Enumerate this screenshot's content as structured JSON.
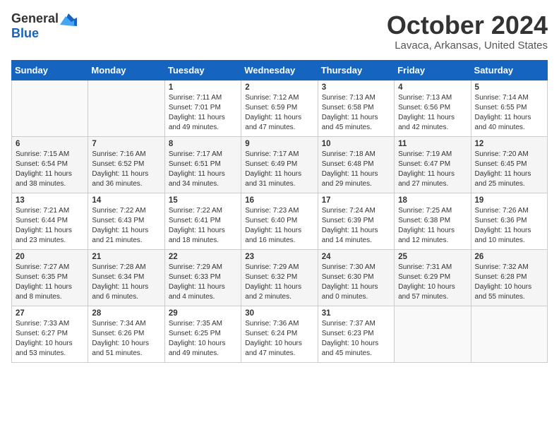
{
  "header": {
    "logo_general": "General",
    "logo_blue": "Blue",
    "month_title": "October 2024",
    "location": "Lavaca, Arkansas, United States"
  },
  "weekdays": [
    "Sunday",
    "Monday",
    "Tuesday",
    "Wednesday",
    "Thursday",
    "Friday",
    "Saturday"
  ],
  "weeks": [
    [
      {
        "day": "",
        "sunrise": "",
        "sunset": "",
        "daylight": ""
      },
      {
        "day": "",
        "sunrise": "",
        "sunset": "",
        "daylight": ""
      },
      {
        "day": "1",
        "sunrise": "Sunrise: 7:11 AM",
        "sunset": "Sunset: 7:01 PM",
        "daylight": "Daylight: 11 hours and 49 minutes."
      },
      {
        "day": "2",
        "sunrise": "Sunrise: 7:12 AM",
        "sunset": "Sunset: 6:59 PM",
        "daylight": "Daylight: 11 hours and 47 minutes."
      },
      {
        "day": "3",
        "sunrise": "Sunrise: 7:13 AM",
        "sunset": "Sunset: 6:58 PM",
        "daylight": "Daylight: 11 hours and 45 minutes."
      },
      {
        "day": "4",
        "sunrise": "Sunrise: 7:13 AM",
        "sunset": "Sunset: 6:56 PM",
        "daylight": "Daylight: 11 hours and 42 minutes."
      },
      {
        "day": "5",
        "sunrise": "Sunrise: 7:14 AM",
        "sunset": "Sunset: 6:55 PM",
        "daylight": "Daylight: 11 hours and 40 minutes."
      }
    ],
    [
      {
        "day": "6",
        "sunrise": "Sunrise: 7:15 AM",
        "sunset": "Sunset: 6:54 PM",
        "daylight": "Daylight: 11 hours and 38 minutes."
      },
      {
        "day": "7",
        "sunrise": "Sunrise: 7:16 AM",
        "sunset": "Sunset: 6:52 PM",
        "daylight": "Daylight: 11 hours and 36 minutes."
      },
      {
        "day": "8",
        "sunrise": "Sunrise: 7:17 AM",
        "sunset": "Sunset: 6:51 PM",
        "daylight": "Daylight: 11 hours and 34 minutes."
      },
      {
        "day": "9",
        "sunrise": "Sunrise: 7:17 AM",
        "sunset": "Sunset: 6:49 PM",
        "daylight": "Daylight: 11 hours and 31 minutes."
      },
      {
        "day": "10",
        "sunrise": "Sunrise: 7:18 AM",
        "sunset": "Sunset: 6:48 PM",
        "daylight": "Daylight: 11 hours and 29 minutes."
      },
      {
        "day": "11",
        "sunrise": "Sunrise: 7:19 AM",
        "sunset": "Sunset: 6:47 PM",
        "daylight": "Daylight: 11 hours and 27 minutes."
      },
      {
        "day": "12",
        "sunrise": "Sunrise: 7:20 AM",
        "sunset": "Sunset: 6:45 PM",
        "daylight": "Daylight: 11 hours and 25 minutes."
      }
    ],
    [
      {
        "day": "13",
        "sunrise": "Sunrise: 7:21 AM",
        "sunset": "Sunset: 6:44 PM",
        "daylight": "Daylight: 11 hours and 23 minutes."
      },
      {
        "day": "14",
        "sunrise": "Sunrise: 7:22 AM",
        "sunset": "Sunset: 6:43 PM",
        "daylight": "Daylight: 11 hours and 21 minutes."
      },
      {
        "day": "15",
        "sunrise": "Sunrise: 7:22 AM",
        "sunset": "Sunset: 6:41 PM",
        "daylight": "Daylight: 11 hours and 18 minutes."
      },
      {
        "day": "16",
        "sunrise": "Sunrise: 7:23 AM",
        "sunset": "Sunset: 6:40 PM",
        "daylight": "Daylight: 11 hours and 16 minutes."
      },
      {
        "day": "17",
        "sunrise": "Sunrise: 7:24 AM",
        "sunset": "Sunset: 6:39 PM",
        "daylight": "Daylight: 11 hours and 14 minutes."
      },
      {
        "day": "18",
        "sunrise": "Sunrise: 7:25 AM",
        "sunset": "Sunset: 6:38 PM",
        "daylight": "Daylight: 11 hours and 12 minutes."
      },
      {
        "day": "19",
        "sunrise": "Sunrise: 7:26 AM",
        "sunset": "Sunset: 6:36 PM",
        "daylight": "Daylight: 11 hours and 10 minutes."
      }
    ],
    [
      {
        "day": "20",
        "sunrise": "Sunrise: 7:27 AM",
        "sunset": "Sunset: 6:35 PM",
        "daylight": "Daylight: 11 hours and 8 minutes."
      },
      {
        "day": "21",
        "sunrise": "Sunrise: 7:28 AM",
        "sunset": "Sunset: 6:34 PM",
        "daylight": "Daylight: 11 hours and 6 minutes."
      },
      {
        "day": "22",
        "sunrise": "Sunrise: 7:29 AM",
        "sunset": "Sunset: 6:33 PM",
        "daylight": "Daylight: 11 hours and 4 minutes."
      },
      {
        "day": "23",
        "sunrise": "Sunrise: 7:29 AM",
        "sunset": "Sunset: 6:32 PM",
        "daylight": "Daylight: 11 hours and 2 minutes."
      },
      {
        "day": "24",
        "sunrise": "Sunrise: 7:30 AM",
        "sunset": "Sunset: 6:30 PM",
        "daylight": "Daylight: 11 hours and 0 minutes."
      },
      {
        "day": "25",
        "sunrise": "Sunrise: 7:31 AM",
        "sunset": "Sunset: 6:29 PM",
        "daylight": "Daylight: 10 hours and 57 minutes."
      },
      {
        "day": "26",
        "sunrise": "Sunrise: 7:32 AM",
        "sunset": "Sunset: 6:28 PM",
        "daylight": "Daylight: 10 hours and 55 minutes."
      }
    ],
    [
      {
        "day": "27",
        "sunrise": "Sunrise: 7:33 AM",
        "sunset": "Sunset: 6:27 PM",
        "daylight": "Daylight: 10 hours and 53 minutes."
      },
      {
        "day": "28",
        "sunrise": "Sunrise: 7:34 AM",
        "sunset": "Sunset: 6:26 PM",
        "daylight": "Daylight: 10 hours and 51 minutes."
      },
      {
        "day": "29",
        "sunrise": "Sunrise: 7:35 AM",
        "sunset": "Sunset: 6:25 PM",
        "daylight": "Daylight: 10 hours and 49 minutes."
      },
      {
        "day": "30",
        "sunrise": "Sunrise: 7:36 AM",
        "sunset": "Sunset: 6:24 PM",
        "daylight": "Daylight: 10 hours and 47 minutes."
      },
      {
        "day": "31",
        "sunrise": "Sunrise: 7:37 AM",
        "sunset": "Sunset: 6:23 PM",
        "daylight": "Daylight: 10 hours and 45 minutes."
      },
      {
        "day": "",
        "sunrise": "",
        "sunset": "",
        "daylight": ""
      },
      {
        "day": "",
        "sunrise": "",
        "sunset": "",
        "daylight": ""
      }
    ]
  ]
}
